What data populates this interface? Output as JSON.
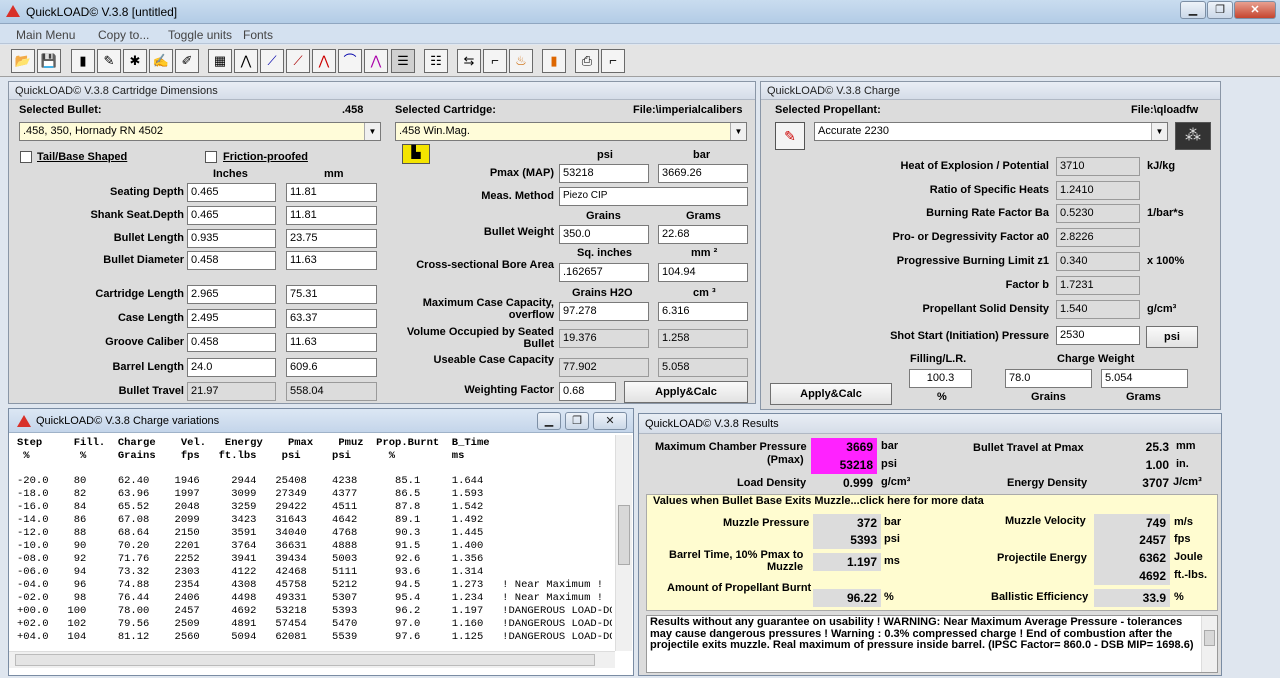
{
  "window": {
    "title": "QuickLOAD© V.3.8   [untitled]",
    "min": "▁",
    "max": "❐",
    "close": "✕"
  },
  "menu": [
    "Main Menu",
    "Copy to...",
    "Toggle units",
    "Fonts"
  ],
  "toolbar_icons": [
    "open-icon",
    "save-icon",
    "bullet-db-icon",
    "bullet-edit-icon",
    "cartridge-db-icon",
    "cartridge-edit-icon",
    "table-icon",
    "chart-pressure-icon",
    "chart-velocity-icon",
    "chart-energy-icon",
    "chart-burn-icon",
    "chart-curve-icon",
    "chart-compare-icon",
    "list-add-icon",
    "list-icon",
    "transfer-icon",
    "rifle-icon",
    "powder-icon",
    "bar-chart-icon",
    "print-icon",
    "gun-icon"
  ],
  "dims": {
    "title": "QuickLOAD© V.3.8 Cartridge Dimensions",
    "sel_bullet_label": "Selected Bullet:",
    "caliber": ".458",
    "bullet": ".458, 350, Hornady RN 4502",
    "sel_cart_label": "Selected Cartridge:",
    "cart_file": "File:\\imperialcalibers",
    "cartridge": ".458 Win.Mag.",
    "tail_label": "Tail/Base Shaped",
    "friction_label": "Friction-proofed",
    "col_in": "Inches",
    "col_mm": "mm",
    "rows": [
      {
        "label": "Seating Depth",
        "in": "0.465",
        "mm": "11.81"
      },
      {
        "label": "Shank Seat.Depth",
        "in": "0.465",
        "mm": "11.81"
      },
      {
        "label": "Bullet Length",
        "in": "0.935",
        "mm": "23.75"
      },
      {
        "label": "Bullet Diameter",
        "in": "0.458",
        "mm": "11.63"
      },
      {
        "label": "Cartridge Length",
        "in": "2.965",
        "mm": "75.31"
      },
      {
        "label": "Case Length",
        "in": "2.495",
        "mm": "63.37"
      },
      {
        "label": "Groove Caliber",
        "in": "0.458",
        "mm": "11.63"
      },
      {
        "label": "Barrel Length",
        "in": "24.0",
        "mm": "609.6"
      },
      {
        "label": "Bullet Travel",
        "in": "21.97",
        "mm": "558.04"
      }
    ],
    "psi": "psi",
    "bar": "bar",
    "pmax_label": "Pmax (MAP)",
    "pmax_psi": "53218",
    "pmax_bar": "3669.26",
    "meas_label": "Meas. Method",
    "meas": "Piezo CIP",
    "grains": "Grains",
    "grams": "Grams",
    "bw_label": "Bullet Weight",
    "bw_gr": "350.0",
    "bw_g": "22.68",
    "sqin": "Sq. inches",
    "mm2": "mm ²",
    "bore_label": "Cross-sectional Bore Area",
    "bore_in": ".162657",
    "bore_mm": "104.94",
    "gh2o": "Grains H2O",
    "cm3": "cm ³",
    "cap_label1": "Maximum Case Capacity,",
    "cap_label2": "overflow",
    "cap_gr": "97.278",
    "cap_cm": "6.316",
    "vol_label1": "Volume Occupied by Seated",
    "vol_label2": "Bullet",
    "vol_gr": "19.376",
    "vol_cm": "1.258",
    "use_label": "Useable Case Capacity",
    "use_gr": "77.902",
    "use_cm": "5.058",
    "wf_label": "Weighting Factor",
    "wf": "0.68",
    "apply": "Apply&Calc"
  },
  "charge": {
    "title": "QuickLOAD© V.3.8 Charge",
    "prop_label": "Selected Propellant:",
    "file": "File:\\qloadfw",
    "propellant": "Accurate 2230",
    "rows": [
      {
        "label": "Heat of Explosion / Potential",
        "val": "3710",
        "unit": "kJ/kg"
      },
      {
        "label": "Ratio of Specific Heats",
        "val": "1.2410",
        "unit": ""
      },
      {
        "label": "Burning Rate Factor  Ba",
        "val": "0.5230",
        "unit": "1/bar*s"
      },
      {
        "label": "Pro- or Degressivity Factor  a0",
        "val": "2.8226",
        "unit": ""
      },
      {
        "label": "Progressive Burning Limit z1",
        "val": "0.340",
        "unit": "x 100%"
      },
      {
        "label": "Factor  b",
        "val": "1.7231",
        "unit": ""
      },
      {
        "label": "Propellant Solid Density",
        "val": "1.540",
        "unit": "g/cm³"
      }
    ],
    "shot_label": "Shot Start (Initiation) Pressure",
    "shot": "2530",
    "shot_unit": "psi",
    "fill_label": "Filling/L.R.",
    "cw_label": "Charge Weight",
    "fill": "100.3",
    "cw_gr": "78.0",
    "cw_g": "5.054",
    "pct": "%",
    "grains": "Grains",
    "grams": "Grams",
    "apply": "Apply&Calc"
  },
  "var": {
    "title": "QuickLOAD© V.3.8 Charge variations",
    "header1": "Step     Fill.  Charge    Vel.   Energy    Pmax    Pmuz  Prop.Burnt  B_Time",
    "header2": " %        %     Grains    fps   ft.lbs    psi     psi      %         ms",
    "rows": [
      "-20.0    80     62.40    1946     2944   25408    4238      85.1     1.644",
      "-18.0    82     63.96    1997     3099   27349    4377      86.5     1.593",
      "-16.0    84     65.52    2048     3259   29422    4511      87.8     1.542",
      "-14.0    86     67.08    2099     3423   31643    4642      89.1     1.492",
      "-12.0    88     68.64    2150     3591   34040    4768      90.3     1.445",
      "-10.0    90     70.20    2201     3764   36631    4888      91.5     1.400",
      "-08.0    92     71.76    2252     3941   39434    5003      92.6     1.356",
      "-06.0    94     73.32    2303     4122   42468    5111      93.6     1.314",
      "-04.0    96     74.88    2354     4308   45758    5212      94.5     1.273   ! Near Maximum !",
      "-02.0    98     76.44    2406     4498   49331    5307      95.4     1.234   ! Near Maximum !",
      "+00.0   100     78.00    2457     4692   53218    5393      96.2     1.197   !DANGEROUS LOAD-DO NO",
      "+02.0   102     79.56    2509     4891   57454    5470      97.0     1.160   !DANGEROUS LOAD-DO NO",
      "+04.0   104     81.12    2560     5094   62081    5539      97.6     1.125   !DANGEROUS LOAD-DO NO"
    ]
  },
  "res": {
    "title": "QuickLOAD© V.3.8 Results",
    "mcp_label1": "Maximum Chamber Pressure",
    "mcp_label2": "(Pmax)",
    "mcp_bar": "3669",
    "mcp_psi": "53218",
    "bar": "bar",
    "psi": "psi",
    "bt_label": "Bullet Travel at Pmax",
    "bt_mm": "25.3",
    "mm": "mm",
    "bt_in": "1.00",
    "in": "in.",
    "ld_label": "Load Density",
    "ld": "0.999",
    "gcm": "g/cm³",
    "ed_label": "Energy Density",
    "ed": "3707",
    "jcm": "J/cm³",
    "muzzle_title": "Values when Bullet Base Exits Muzzle...click here for more data",
    "mp_label": "Muzzle Pressure",
    "mp_bar": "372",
    "mp_psi": "5393",
    "mv_label": "Muzzle Velocity",
    "mv_ms": "749",
    "ms": "m/s",
    "mv_fps": "2457",
    "fps": "fps",
    "btime_label1": "Barrel Time, 10% Pmax to",
    "btime_label2": "Muzzle",
    "btime": "1.197",
    "msec": "ms",
    "pe_label": "Projectile Energy",
    "pe_j": "6362",
    "joule": "Joule",
    "pe_ft": "4692",
    "ftlbs": "ft.-lbs.",
    "amt_label": "Amount of Propellant Burnt",
    "amt": "96.22",
    "pct": "%",
    "be_label": "Ballistic Efficiency",
    "be": "33.9",
    "notes": "Results without any guarantee on usability !  WARNING: Near Maximum Average Pressure - tolerances may cause dangerous pressures !  Warning : 0.3% compressed charge !  End of combustion after the projectile exits muzzle.  Real maximum of pressure inside barrel.  (IPSC Factor= 860.0 - DSB MIP= 1698.6)"
  },
  "colors": {
    "highlight": "#ff22ff",
    "yellow": "#fffcd9"
  }
}
